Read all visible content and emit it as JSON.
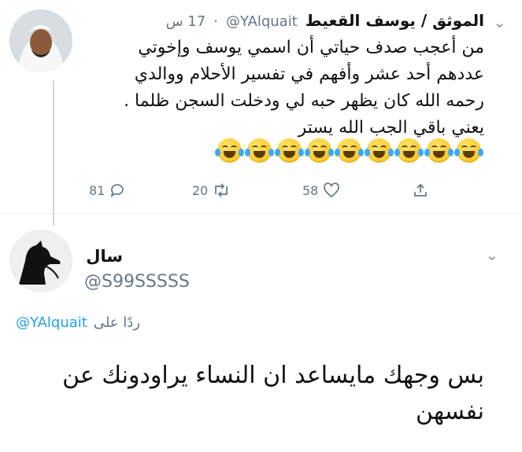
{
  "tweet": {
    "display_name": "الموثق / يوسف القعيط",
    "handle": "@YAlquait",
    "time": "17 س",
    "text_lines": [
      "من أعجب صدف حياتي أن اسمي يوسف وإخوتي",
      "عددهم أحد عشر وأفهم في تفسير الأحلام ووالدي",
      "رحمه الله كان يظهر حبه لي ودخلت السجن ظلما .",
      "يعني باقي الجب الله يستر"
    ],
    "emoji_count": 9,
    "emoji_name": "face-with-tears-of-joy",
    "replies": "81",
    "retweets": "20",
    "likes": "58"
  },
  "reply": {
    "display_name": "سال",
    "handle": "@S99SSSSS",
    "replying_to_label": "ردًا على",
    "replying_to_handle": "@YAlquait",
    "text_lines": [
      "بس وجهك مايساعد ان النساء يراودونك عن",
      "نفسهن"
    ]
  },
  "colors": {
    "accent": "#1da1f2",
    "muted": "#657786",
    "thread_line": "#cfd9de"
  },
  "icons": [
    "reply-icon",
    "retweet-icon",
    "like-icon",
    "share-icon",
    "chevron-down-icon"
  ]
}
